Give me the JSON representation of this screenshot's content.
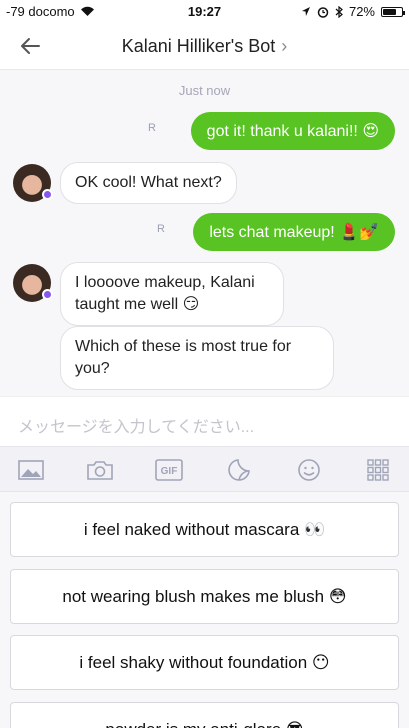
{
  "status_bar": {
    "carrier": "-79 docomo",
    "time": "19:27",
    "battery": "72%",
    "battery_level": 0.72
  },
  "header": {
    "title": "Kalani Hilliker's Bot",
    "chevron": "›"
  },
  "chat": {
    "timestamp": "Just now",
    "read_mark": "R",
    "messages": [
      {
        "side": "out",
        "text": "got it! thank u kalani!! 😍"
      },
      {
        "side": "in",
        "text": "OK cool! What next?"
      },
      {
        "side": "out",
        "text": "lets chat makeup! 💄💅"
      },
      {
        "side": "in",
        "text": "I loooove makeup, Kalani taught me well 😏"
      },
      {
        "side": "in",
        "text": "Which of these is most true for you?"
      }
    ]
  },
  "composer": {
    "placeholder": "メッセージを入力してください..."
  },
  "toolbar": {
    "icons": [
      "image-icon",
      "camera-icon",
      "gif-icon",
      "sticker-icon",
      "emoji-icon",
      "grid-icon"
    ],
    "gif_label": "GIF"
  },
  "quick_replies": [
    "i feel naked without mascara 👀",
    "not wearing blush makes me blush 😳",
    "i feel shaky without foundation 😶",
    "powder is my anti-glare 😎"
  ],
  "colors": {
    "outgoing_bubble": "#58c322",
    "badge": "#8a56f0"
  }
}
